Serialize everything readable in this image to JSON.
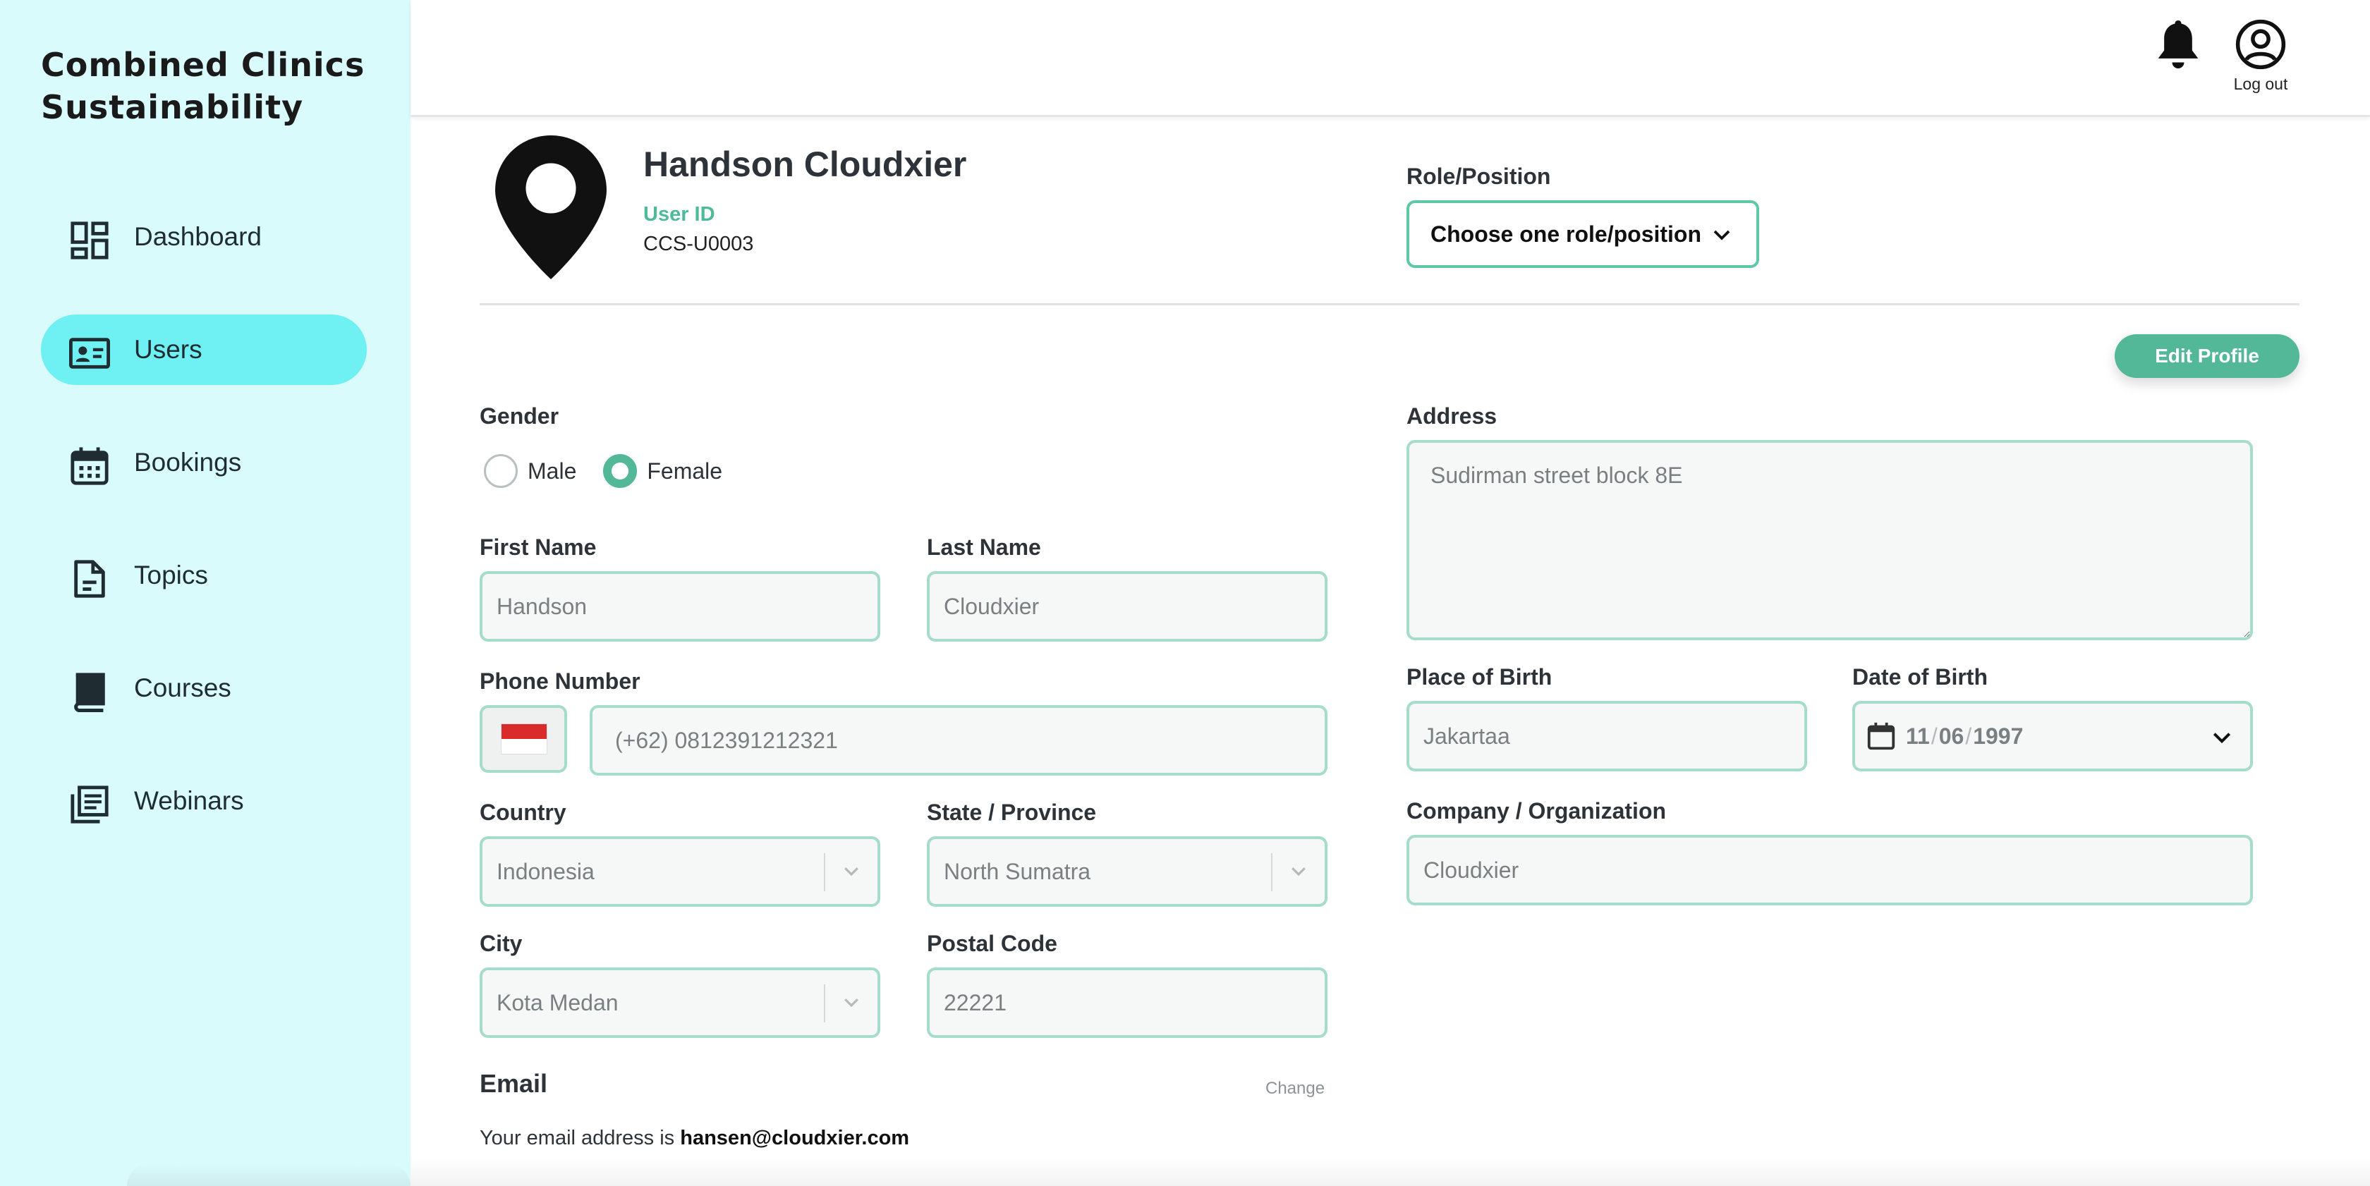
{
  "brand": {
    "title": "Combined Clinics Sustainability"
  },
  "sidebar": {
    "items": [
      {
        "label": "Dashboard",
        "icon": "dashboard-icon"
      },
      {
        "label": "Users",
        "icon": "id-card-icon",
        "active": true
      },
      {
        "label": "Bookings",
        "icon": "calendar-icon"
      },
      {
        "label": "Topics",
        "icon": "document-icon"
      },
      {
        "label": "Courses",
        "icon": "book-icon"
      },
      {
        "label": "Webinars",
        "icon": "newspaper-icon"
      }
    ]
  },
  "header": {
    "logout_label": "Log out"
  },
  "profile": {
    "name": "Handson Cloudxier",
    "user_id_label": "User ID",
    "user_id": "CCS-U0003",
    "role_label": "Role/Position",
    "role_placeholder": "Choose one role/position",
    "edit_button": "Edit Profile"
  },
  "form": {
    "gender_label": "Gender",
    "gender_options": [
      "Male",
      "Female"
    ],
    "gender_selected": "Female",
    "first_name_label": "First Name",
    "first_name": "Handson",
    "last_name_label": "Last Name",
    "last_name": "Cloudxier",
    "phone_label": "Phone Number",
    "phone": "(+62) 0812391212321",
    "country_label": "Country",
    "country": "Indonesia",
    "state_label": "State / Province",
    "state": "North Sumatra",
    "city_label": "City",
    "city": "Kota Medan",
    "postal_label": "Postal Code",
    "postal": "22221",
    "address_label": "Address",
    "address": "Sudirman street block 8E",
    "birth_place_label": "Place of Birth",
    "birth_place": "Jakartaa",
    "birth_date_label": "Date of Birth",
    "birth_date": {
      "month": "11",
      "day": "06",
      "year": "1997"
    },
    "company_label": "Company / Organization",
    "company": "Cloudxier"
  },
  "email": {
    "title": "Email",
    "change_label": "Change",
    "prefix": "Your email address is ",
    "address": "hansen@cloudxier.com"
  },
  "colors": {
    "sidebar_bg": "#d9fbfc",
    "active_nav": "#6ff0f3",
    "accent": "#52b898",
    "field_border": "#a6dccb"
  }
}
